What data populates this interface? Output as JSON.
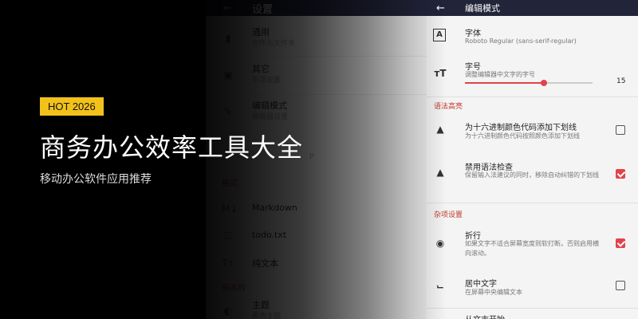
{
  "banner": {
    "badge": "HOT 2026",
    "headline": "商务办公效率工具大全",
    "subline": "移动办公软件应用推荐"
  },
  "settings_screen": {
    "back_icon": "arrow-left-icon",
    "title": "设置",
    "items": [
      {
        "icon": "file-icon",
        "title": "通用",
        "subtitle": "文件与文件夹"
      },
      {
        "icon": "misc-icon",
        "title": "其它",
        "subtitle": "杂项设置"
      },
      {
        "icon": "pencil-icon",
        "title": "编辑模式",
        "subtitle": "编辑器设置"
      },
      {
        "icon": "gear-icon",
        "title": "",
        "subtitle": "p"
      }
    ],
    "section_formats": "格式",
    "format_items": [
      {
        "icon": "markdown-icon",
        "title": "Markdown"
      },
      {
        "icon": "checklist-icon",
        "title": "todo.txt"
      },
      {
        "icon": "text-icon",
        "title": "纯文本"
      }
    ],
    "section_basic": "基本的",
    "bottom_item": {
      "icon": "theme-icon",
      "title": "主题",
      "subtitle": "黑色主题"
    }
  },
  "editor_screen": {
    "back_icon": "arrow-left-icon",
    "title": "编辑模式",
    "font": {
      "icon": "font-icon",
      "title": "字体",
      "subtitle": "Roboto Regular (sans-serif-regular)"
    },
    "font_size": {
      "icon": "text-size-icon",
      "title": "字号",
      "subtitle": "调整编辑器中文字的字号",
      "value": "15",
      "fraction": 0.62
    },
    "section_syntax": "语法高亮",
    "hex_underline": {
      "icon": "format-color-icon",
      "title": "为十六进制颜色代码添加下划线",
      "subtitle": "为十六进制颜色代码按照颜色添加下划线",
      "checked": false
    },
    "disable_spell": {
      "icon": "format-color-icon",
      "title": "禁用语法检查",
      "subtitle": "保留输入法建议的同时，移除自动纠错的下划线",
      "checked": true
    },
    "section_misc": "杂项设置",
    "wrap": {
      "icon": "eye-icon",
      "title": "折行",
      "subtitle": "如果文字不适合屏幕宽度则软打断。否则启用横向滚动。",
      "checked": true
    },
    "center": {
      "icon": "center-focus-icon",
      "title": "居中文字",
      "subtitle": "在屏幕中央编辑文本",
      "checked": false
    },
    "partial": {
      "title": "从文末开始"
    }
  }
}
